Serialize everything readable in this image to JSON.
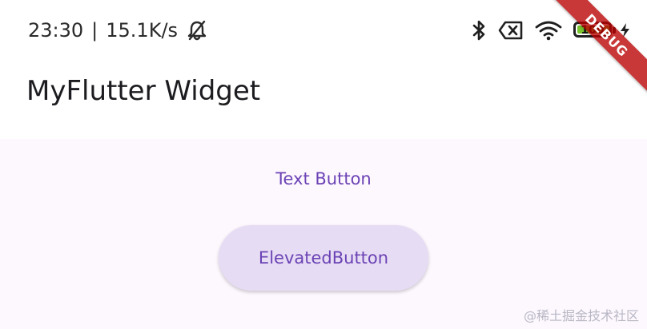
{
  "status_bar": {
    "time": "23:30",
    "separator": "|",
    "network_speed": "15.1K/s",
    "battery_level": "100",
    "icons": {
      "left": [
        "bell-off-icon"
      ],
      "right": [
        "bluetooth-icon",
        "sim-off-icon",
        "wifi-icon",
        "battery-icon",
        "charging-bolt-icon"
      ]
    },
    "battery_fill_color": "#77c42d"
  },
  "app_bar": {
    "title": "MyFlutter Widget"
  },
  "content": {
    "text_button_label": "Text Button",
    "elevated_button_label": "ElevatedButton",
    "accent_color": "#6b43b5",
    "elevated_button_background": "#e6dcf4",
    "surface_background": "#fdf7fe"
  },
  "debug_banner": {
    "label": "DEBUG",
    "color": "#b80000"
  },
  "watermark": {
    "text": "@稀土掘金技术社区"
  }
}
